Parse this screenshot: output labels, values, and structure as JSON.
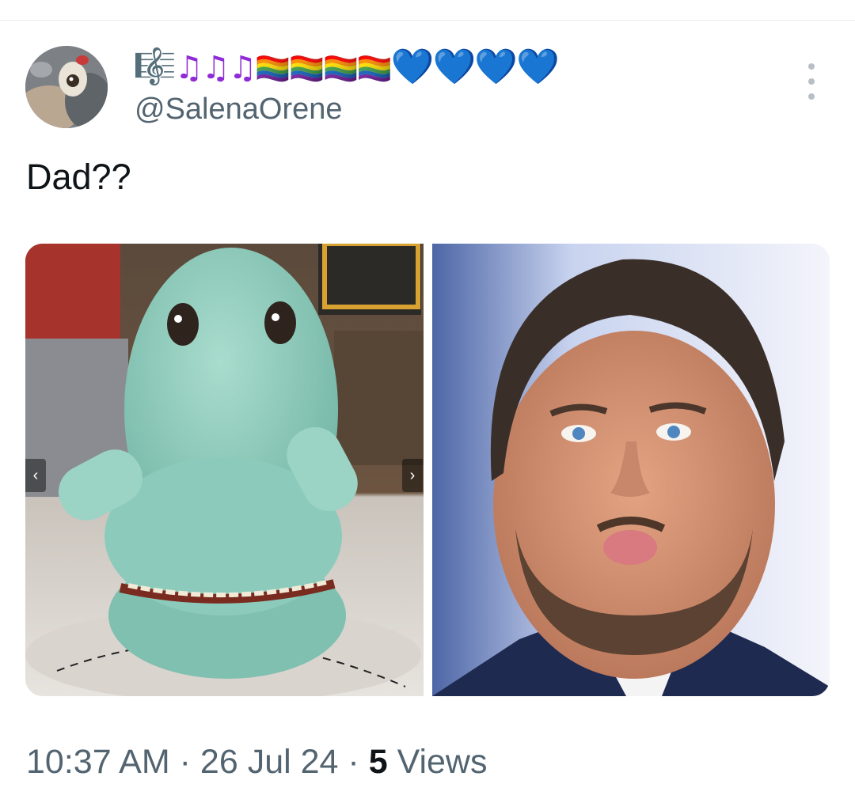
{
  "tweet": {
    "author": {
      "display_name": {
        "treble": "🎼",
        "notes": "♫♫♫",
        "flags": "🏳️‍🌈🏳️‍🌈🏳️‍🌈🏳️‍🌈",
        "hearts": "💙💙💙💙"
      },
      "handle": "@SalenaOrene"
    },
    "text": "Dad??",
    "media": {
      "count": 2,
      "prev_label": "‹",
      "next_label": "›"
    },
    "meta": {
      "time": "10:37 AM",
      "separator": "·",
      "date": "26 Jul 24",
      "views_count": "5",
      "views_label": "Views"
    }
  },
  "colors": {
    "secondary_text": "#536471",
    "primary_text": "#0f1419",
    "heart_blue": "#1d8fe3",
    "note_purple": "#8f2bd6"
  },
  "icons": {
    "more": "more-options-icon",
    "prev": "chevron-left-icon",
    "next": "chevron-right-icon"
  }
}
